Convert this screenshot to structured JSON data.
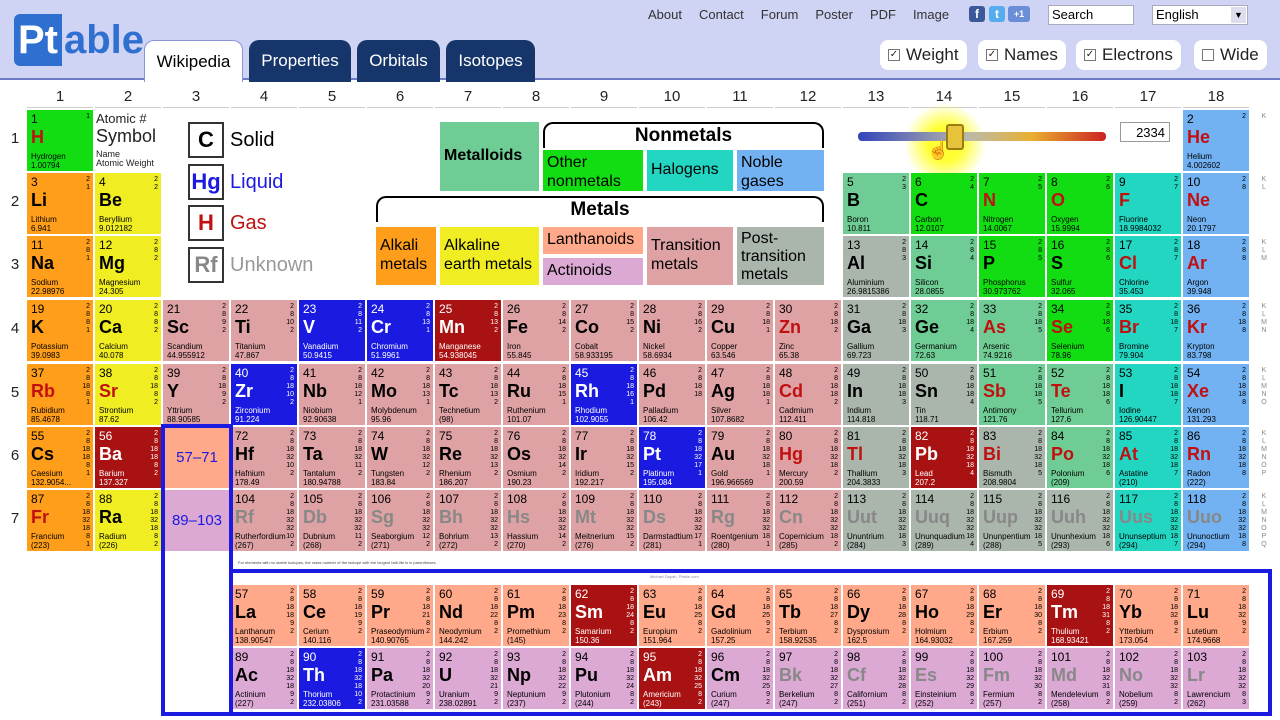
{
  "colors": {
    "header_bg": "#cfd3f4",
    "tab_dark": "#15356b",
    "accent": "#2e6fd0"
  },
  "logo": {
    "pt": "Pt",
    "able": "able"
  },
  "tabs": [
    {
      "label": "Wikipedia"
    },
    {
      "label": "Properties"
    },
    {
      "label": "Orbitals"
    },
    {
      "label": "Isotopes"
    }
  ],
  "toplinks": [
    "About",
    "Contact",
    "Forum",
    "Poster",
    "PDF",
    "Image"
  ],
  "social": [
    "f",
    "t",
    "+1"
  ],
  "search": {
    "placeholder": "Search"
  },
  "language": {
    "value": "English"
  },
  "options": [
    {
      "label": "Weight",
      "checked": true
    },
    {
      "label": "Names",
      "checked": true
    },
    {
      "label": "Electrons",
      "checked": true
    },
    {
      "label": "Wide",
      "checked": false
    }
  ],
  "groups": [
    "1",
    "2",
    "3",
    "4",
    "5",
    "6",
    "7",
    "8",
    "9",
    "10",
    "11",
    "12",
    "13",
    "14",
    "15",
    "16",
    "17",
    "18"
  ],
  "periods": [
    "1",
    "2",
    "3",
    "4",
    "5",
    "6",
    "7"
  ],
  "legend": {
    "atomic_label": "Atomic #",
    "symbol_label": "Symbol",
    "name_label": "Name",
    "weight_label": "Atomic Weight",
    "states": [
      {
        "sym": "C",
        "label": "Solid"
      },
      {
        "sym": "Hg",
        "label": "Liquid"
      },
      {
        "sym": "H",
        "label": "Gas"
      },
      {
        "sym": "Rf",
        "label": "Unknown"
      }
    ],
    "nonmetals_title": "Nonmetals",
    "metals_title": "Metals",
    "metalloids": "Metalloids",
    "other_nonmetals": "Other nonmetals",
    "halogens": "Halogens",
    "noble_gases": "Noble gases",
    "alkali": "Alkali metals",
    "alkaline_earth": "Alkaline earth metals",
    "lanthanoids": "Lanthanoids",
    "actinoids": "Actinoids",
    "transition": "Transition metals",
    "post_transition": "Post-transition metals"
  },
  "slider": {
    "temperature": "2334"
  },
  "ranges": {
    "lanth": "57–71",
    "actin": "89–103"
  },
  "footnote": "For elements with no stable isotopes, the mass number of the isotope with the longest half-life is in parentheses.",
  "copyright": "Michael Dayah. Ptable.com",
  "shell_letters": [
    "K",
    "KL",
    "KLM",
    "KLMN",
    "KLMNO",
    "KLMNOP",
    "KLMNOPQ"
  ],
  "elements": [
    [
      "1",
      "H",
      "Hydrogen",
      "1.00794",
      "1",
      "1",
      "1",
      "gas",
      "nonmetal"
    ],
    [
      "2",
      "He",
      "Helium",
      "4.002602",
      "1",
      "18",
      "2",
      "gas",
      "noble"
    ],
    [
      "3",
      "Li",
      "Lithium",
      "6.941",
      "2",
      "1",
      "2 1",
      "solid",
      "alkali"
    ],
    [
      "4",
      "Be",
      "Beryllium",
      "9.012182",
      "2",
      "2",
      "2 2",
      "solid",
      "alkaline"
    ],
    [
      "5",
      "B",
      "Boron",
      "10.811",
      "2",
      "13",
      "2 3",
      "solid",
      "metalloid"
    ],
    [
      "6",
      "C",
      "Carbon",
      "12.0107",
      "2",
      "14",
      "2 4",
      "solid",
      "nonmetal"
    ],
    [
      "7",
      "N",
      "Nitrogen",
      "14.0067",
      "2",
      "15",
      "2 5",
      "gas",
      "nonmetal"
    ],
    [
      "8",
      "O",
      "Oxygen",
      "15.9994",
      "2",
      "16",
      "2 6",
      "gas",
      "nonmetal"
    ],
    [
      "9",
      "F",
      "Fluorine",
      "18.9984032",
      "2",
      "17",
      "2 7",
      "gas",
      "halogen"
    ],
    [
      "10",
      "Ne",
      "Neon",
      "20.1797",
      "2",
      "18",
      "2 8",
      "gas",
      "noble"
    ],
    [
      "11",
      "Na",
      "Sodium",
      "22.98976",
      "3",
      "1",
      "2 8 1",
      "solid",
      "alkali"
    ],
    [
      "12",
      "Mg",
      "Magnesium",
      "24.305",
      "3",
      "2",
      "2 8 2",
      "solid",
      "alkaline"
    ],
    [
      "13",
      "Al",
      "Aluminium",
      "26.9815386",
      "3",
      "13",
      "2 8 3",
      "solid",
      "post"
    ],
    [
      "14",
      "Si",
      "Silicon",
      "28.0855",
      "3",
      "14",
      "2 8 4",
      "solid",
      "metalloid"
    ],
    [
      "15",
      "P",
      "Phosphorus",
      "30.973762",
      "3",
      "15",
      "2 8 5",
      "solid",
      "nonmetal"
    ],
    [
      "16",
      "S",
      "Sulfur",
      "32.065",
      "3",
      "16",
      "2 8 6",
      "solid",
      "nonmetal"
    ],
    [
      "17",
      "Cl",
      "Chlorine",
      "35.453",
      "3",
      "17",
      "2 8 7",
      "gas",
      "halogen"
    ],
    [
      "18",
      "Ar",
      "Argon",
      "39.948",
      "3",
      "18",
      "2 8 8",
      "gas",
      "noble"
    ],
    [
      "19",
      "K",
      "Potassium",
      "39.0983",
      "4",
      "1",
      "2 8 8 1",
      "solid",
      "alkali"
    ],
    [
      "20",
      "Ca",
      "Calcium",
      "40.078",
      "4",
      "2",
      "2 8 8 2",
      "solid",
      "alkaline"
    ],
    [
      "21",
      "Sc",
      "Scandium",
      "44.955912",
      "4",
      "3",
      "2 8 9 2",
      "solid",
      "transition"
    ],
    [
      "22",
      "Ti",
      "Titanium",
      "47.867",
      "4",
      "4",
      "2 8 10 2",
      "solid",
      "transition"
    ],
    [
      "23",
      "V",
      "Vanadium",
      "50.9415",
      "4",
      "5",
      "2 8 11 2",
      "liquid",
      "transition"
    ],
    [
      "24",
      "Cr",
      "Chromium",
      "51.9961",
      "4",
      "6",
      "2 8 13 1",
      "liquid",
      "transition"
    ],
    [
      "25",
      "Mn",
      "Manganese",
      "54.938045",
      "4",
      "7",
      "2 8 13 2",
      "gas",
      "transition"
    ],
    [
      "26",
      "Fe",
      "Iron",
      "55.845",
      "4",
      "8",
      "2 8 14 2",
      "solid",
      "transition"
    ],
    [
      "27",
      "Co",
      "Cobalt",
      "58.933195",
      "4",
      "9",
      "2 8 15 2",
      "solid",
      "transition"
    ],
    [
      "28",
      "Ni",
      "Nickel",
      "58.6934",
      "4",
      "10",
      "2 8 16 2",
      "solid",
      "transition"
    ],
    [
      "29",
      "Cu",
      "Copper",
      "63.546",
      "4",
      "11",
      "2 8 18 1",
      "solid",
      "transition"
    ],
    [
      "30",
      "Zn",
      "Zinc",
      "65.38",
      "4",
      "12",
      "2 8 18 2",
      "gas",
      "transition"
    ],
    [
      "31",
      "Ga",
      "Gallium",
      "69.723",
      "4",
      "13",
      "2 8 18 3",
      "solid",
      "post"
    ],
    [
      "32",
      "Ge",
      "Germanium",
      "72.63",
      "4",
      "14",
      "2 8 18 4",
      "solid",
      "metalloid"
    ],
    [
      "33",
      "As",
      "Arsenic",
      "74.9216",
      "4",
      "15",
      "2 8 18 5",
      "gas",
      "metalloid"
    ],
    [
      "34",
      "Se",
      "Selenium",
      "78.96",
      "4",
      "16",
      "2 8 18 6",
      "gas",
      "nonmetal"
    ],
    [
      "35",
      "Br",
      "Bromine",
      "79.904",
      "4",
      "17",
      "2 8 18 7",
      "gas",
      "halogen"
    ],
    [
      "36",
      "Kr",
      "Krypton",
      "83.798",
      "4",
      "18",
      "2 8 18 8",
      "gas",
      "noble"
    ],
    [
      "37",
      "Rb",
      "Rubidium",
      "85.4678",
      "5",
      "1",
      "2 8 18 8 1",
      "gas",
      "alkali"
    ],
    [
      "38",
      "Sr",
      "Strontium",
      "87.62",
      "5",
      "2",
      "2 8 18 8 2",
      "gas",
      "alkaline"
    ],
    [
      "39",
      "Y",
      "Yttrium",
      "88.90585",
      "5",
      "3",
      "2 8 18 9 2",
      "solid",
      "transition"
    ],
    [
      "40",
      "Zr",
      "Zirconium",
      "91.224",
      "5",
      "4",
      "2 8 18 10 2",
      "liquid",
      "transition"
    ],
    [
      "41",
      "Nb",
      "Niobium",
      "92.90638",
      "5",
      "5",
      "2 8 18 12 1",
      "solid",
      "transition"
    ],
    [
      "42",
      "Mo",
      "Molybdenum",
      "95.96",
      "5",
      "6",
      "2 8 18 13 1",
      "solid",
      "transition"
    ],
    [
      "43",
      "Tc",
      "Technetium",
      "(98)",
      "5",
      "7",
      "2 8 18 13 2",
      "solid",
      "transition"
    ],
    [
      "44",
      "Ru",
      "Ruthenium",
      "101.07",
      "5",
      "8",
      "2 8 18 15 1",
      "solid",
      "transition"
    ],
    [
      "45",
      "Rh",
      "Rhodium",
      "102.9055",
      "5",
      "9",
      "2 8 18 16 1",
      "liquid",
      "transition"
    ],
    [
      "46",
      "Pd",
      "Palladium",
      "106.42",
      "5",
      "10",
      "2 8 18 18",
      "solid",
      "transition"
    ],
    [
      "47",
      "Ag",
      "Silver",
      "107.8682",
      "5",
      "11",
      "2 8 18 18 1",
      "solid",
      "transition"
    ],
    [
      "48",
      "Cd",
      "Cadmium",
      "112.411",
      "5",
      "12",
      "2 8 18 18 2",
      "gas",
      "transition"
    ],
    [
      "49",
      "In",
      "Indium",
      "114.818",
      "5",
      "13",
      "2 8 18 18 3",
      "solid",
      "post"
    ],
    [
      "50",
      "Sn",
      "Tin",
      "118.71",
      "5",
      "14",
      "2 8 18 18 4",
      "solid",
      "post"
    ],
    [
      "51",
      "Sb",
      "Antimony",
      "121.76",
      "5",
      "15",
      "2 8 18 18 5",
      "gas",
      "metalloid"
    ],
    [
      "52",
      "Te",
      "Tellurium",
      "127.6",
      "5",
      "16",
      "2 8 18 18 6",
      "gas",
      "metalloid"
    ],
    [
      "53",
      "I",
      "Iodine",
      "126.90447",
      "5",
      "17",
      "2 8 18 18 7",
      "solid",
      "halogen"
    ],
    [
      "54",
      "Xe",
      "Xenon",
      "131.293",
      "5",
      "18",
      "2 8 18 18 8",
      "gas",
      "noble"
    ],
    [
      "55",
      "Cs",
      "Caesium",
      "132.9054...",
      "6",
      "1",
      "2 8 18 18 8 1",
      "solid",
      "alkali"
    ],
    [
      "56",
      "Ba",
      "Barium",
      "137.327",
      "6",
      "2",
      "2 8 18 18 8 2",
      "gas",
      "alkaline"
    ],
    [
      "72",
      "Hf",
      "Hafnium",
      "178.49",
      "6",
      "4",
      "2 8 18 32 10 2",
      "solid",
      "transition"
    ],
    [
      "73",
      "Ta",
      "Tantalum",
      "180.94788",
      "6",
      "5",
      "2 8 18 32 11 2",
      "solid",
      "transition"
    ],
    [
      "74",
      "W",
      "Tungsten",
      "183.84",
      "6",
      "6",
      "2 8 18 32 12 2",
      "solid",
      "transition"
    ],
    [
      "75",
      "Re",
      "Rhenium",
      "186.207",
      "6",
      "7",
      "2 8 18 32 13 2",
      "solid",
      "transition"
    ],
    [
      "76",
      "Os",
      "Osmium",
      "190.23",
      "6",
      "8",
      "2 8 18 32 14 2",
      "solid",
      "transition"
    ],
    [
      "77",
      "Ir",
      "Iridium",
      "192.217",
      "6",
      "9",
      "2 8 18 32 15 2",
      "solid",
      "transition"
    ],
    [
      "78",
      "Pt",
      "Platinum",
      "195.084",
      "6",
      "10",
      "2 8 18 32 17 1",
      "liquid",
      "transition"
    ],
    [
      "79",
      "Au",
      "Gold",
      "196.966569",
      "6",
      "11",
      "2 8 18 32 18 1",
      "solid",
      "transition"
    ],
    [
      "80",
      "Hg",
      "Mercury",
      "200.59",
      "6",
      "12",
      "2 8 18 32 18 2",
      "gas",
      "transition"
    ],
    [
      "81",
      "Tl",
      "Thallium",
      "204.3833",
      "6",
      "13",
      "2 8 18 32 18 3",
      "gas",
      "post"
    ],
    [
      "82",
      "Pb",
      "Lead",
      "207.2",
      "6",
      "14",
      "2 8 18 32 18 4",
      "gas",
      "post"
    ],
    [
      "83",
      "Bi",
      "Bismuth",
      "208.9804",
      "6",
      "15",
      "2 8 18 32 18 5",
      "gas",
      "post"
    ],
    [
      "84",
      "Po",
      "Polonium",
      "(209)",
      "6",
      "16",
      "2 8 18 32 18 6",
      "gas",
      "metalloid"
    ],
    [
      "85",
      "At",
      "Astatine",
      "(210)",
      "6",
      "17",
      "2 8 18 32 18 7",
      "gas",
      "halogen"
    ],
    [
      "86",
      "Rn",
      "Radon",
      "(222)",
      "6",
      "18",
      "2 8 18 32 18 8",
      "gas",
      "noble"
    ],
    [
      "87",
      "Fr",
      "Francium",
      "(223)",
      "7",
      "1",
      "2 8 18 32 18 8 1",
      "gas",
      "alkali"
    ],
    [
      "88",
      "Ra",
      "Radium",
      "(226)",
      "7",
      "2",
      "2 8 18 32 18 8 2",
      "solid",
      "alkaline"
    ],
    [
      "104",
      "Rf",
      "Rutherfordium",
      "(267)",
      "7",
      "4",
      "2 8 18 32 32 10 2",
      "unknown",
      "transition"
    ],
    [
      "105",
      "Db",
      "Dubnium",
      "(268)",
      "7",
      "5",
      "2 8 18 32 32 11 2",
      "unknown",
      "transition"
    ],
    [
      "106",
      "Sg",
      "Seaborgium",
      "(271)",
      "7",
      "6",
      "2 8 18 32 32 12 2",
      "unknown",
      "transition"
    ],
    [
      "107",
      "Bh",
      "Bohrium",
      "(272)",
      "7",
      "7",
      "2 8 18 32 32 13 2",
      "unknown",
      "transition"
    ],
    [
      "108",
      "Hs",
      "Hassium",
      "(270)",
      "7",
      "8",
      "2 8 18 32 32 14 2",
      "unknown",
      "transition"
    ],
    [
      "109",
      "Mt",
      "Meitnerium",
      "(276)",
      "7",
      "9",
      "2 8 18 32 32 15 2",
      "unknown",
      "transition"
    ],
    [
      "110",
      "Ds",
      "Darmstadtium",
      "(281)",
      "7",
      "10",
      "2 8 18 32 32 17 1",
      "unknown",
      "transition"
    ],
    [
      "111",
      "Rg",
      "Roentgenium",
      "(280)",
      "7",
      "11",
      "2 8 18 32 32 18 1",
      "unknown",
      "transition"
    ],
    [
      "112",
      "Cn",
      "Copernicium",
      "(285)",
      "7",
      "12",
      "2 8 18 32 32 18 2",
      "unknown",
      "transition"
    ],
    [
      "113",
      "Uut",
      "Ununtrium",
      "(284)",
      "7",
      "13",
      "2 8 18 32 32 18 3",
      "unknown",
      "post"
    ],
    [
      "114",
      "Uuq",
      "Ununquadium",
      "(289)",
      "7",
      "14",
      "2 8 18 32 32 18 4",
      "unknown",
      "post"
    ],
    [
      "115",
      "Uup",
      "Ununpentium",
      "(288)",
      "7",
      "15",
      "2 8 18 32 32 18 5",
      "unknown",
      "post"
    ],
    [
      "116",
      "Uuh",
      "Ununhexium",
      "(293)",
      "7",
      "16",
      "2 8 18 32 32 18 6",
      "unknown",
      "post"
    ],
    [
      "117",
      "Uus",
      "Ununseptium",
      "(294)",
      "7",
      "17",
      "2 8 18 32 32 18 7",
      "unknown",
      "halogen"
    ],
    [
      "118",
      "Uuo",
      "Ununoctium",
      "(294)",
      "7",
      "18",
      "2 8 18 32 32 18 8",
      "unknown",
      "noble"
    ],
    [
      "57",
      "La",
      "Lanthanum",
      "138.90547",
      "9",
      "4",
      "2 8 18 18 9 2",
      "solid",
      "lanth"
    ],
    [
      "58",
      "Ce",
      "Cerium",
      "140.116",
      "9",
      "5",
      "2 8 18 19 9 2",
      "solid",
      "lanth"
    ],
    [
      "59",
      "Pr",
      "Praseodymium",
      "140.90765",
      "9",
      "6",
      "2 8 18 21 8 2",
      "solid",
      "lanth"
    ],
    [
      "60",
      "Nd",
      "Neodymium",
      "144.242",
      "9",
      "7",
      "2 8 18 22 8 2",
      "solid",
      "lanth"
    ],
    [
      "61",
      "Pm",
      "Promethium",
      "(145)",
      "9",
      "8",
      "2 8 18 23 8 2",
      "solid",
      "lanth"
    ],
    [
      "62",
      "Sm",
      "Samarium",
      "150.36",
      "9",
      "9",
      "2 8 18 24 8 2",
      "gas",
      "lanth"
    ],
    [
      "63",
      "Eu",
      "Europium",
      "151.964",
      "9",
      "10",
      "2 8 18 25 8 2",
      "solid",
      "lanth"
    ],
    [
      "64",
      "Gd",
      "Gadolinium",
      "157.25",
      "9",
      "11",
      "2 8 18 25 9 2",
      "solid",
      "lanth"
    ],
    [
      "65",
      "Tb",
      "Terbium",
      "158.92535",
      "9",
      "12",
      "2 8 18 27 8 2",
      "solid",
      "lanth"
    ],
    [
      "66",
      "Dy",
      "Dysprosium",
      "162.5",
      "9",
      "13",
      "2 8 18 28 8 2",
      "solid",
      "lanth"
    ],
    [
      "67",
      "Ho",
      "Holmium",
      "164.93032",
      "9",
      "14",
      "2 8 18 29 8 2",
      "solid",
      "lanth"
    ],
    [
      "68",
      "Er",
      "Erbium",
      "167.259",
      "9",
      "15",
      "2 8 18 30 8 2",
      "solid",
      "lanth"
    ],
    [
      "69",
      "Tm",
      "Thulium",
      "168.93421",
      "9",
      "16",
      "2 8 18 31 8 2",
      "gas",
      "lanth"
    ],
    [
      "70",
      "Yb",
      "Ytterbium",
      "173.054",
      "9",
      "17",
      "2 8 18 32 8 2",
      "solid",
      "lanth"
    ],
    [
      "71",
      "Lu",
      "Lutetium",
      "174.9668",
      "9",
      "18",
      "2 8 18 32 9 2",
      "solid",
      "lanth"
    ],
    [
      "89",
      "Ac",
      "Actinium",
      "(227)",
      "10",
      "4",
      "2 8 18 32 18 9 2",
      "solid",
      "actin"
    ],
    [
      "90",
      "Th",
      "Thorium",
      "232.03806",
      "10",
      "5",
      "2 8 18 32 18 10 2",
      "liquid",
      "actin"
    ],
    [
      "91",
      "Pa",
      "Protactinium",
      "231.03588",
      "10",
      "6",
      "2 8 18 32 20 9 2",
      "solid",
      "actin"
    ],
    [
      "92",
      "U",
      "Uranium",
      "238.02891",
      "10",
      "7",
      "2 8 18 32 21 9 2",
      "solid",
      "actin"
    ],
    [
      "93",
      "Np",
      "Neptunium",
      "(237)",
      "10",
      "8",
      "2 8 18 32 22 9 2",
      "solid",
      "actin"
    ],
    [
      "94",
      "Pu",
      "Plutonium",
      "(244)",
      "10",
      "9",
      "2 8 18 32 24 8 2",
      "solid",
      "actin"
    ],
    [
      "95",
      "Am",
      "Americium",
      "(243)",
      "10",
      "10",
      "2 8 18 32 25 8 2",
      "gas",
      "actin"
    ],
    [
      "96",
      "Cm",
      "Curium",
      "(247)",
      "10",
      "11",
      "2 8 18 32 25 9 2",
      "solid",
      "actin"
    ],
    [
      "97",
      "Bk",
      "Berkelium",
      "(247)",
      "10",
      "12",
      "2 8 18 32 27 8 2",
      "unknown",
      "actin"
    ],
    [
      "98",
      "Cf",
      "Californium",
      "(251)",
      "10",
      "13",
      "2 8 18 32 28 8 2",
      "unknown",
      "actin"
    ],
    [
      "99",
      "Es",
      "Einsteinium",
      "(252)",
      "10",
      "14",
      "2 8 18 32 29 8 2",
      "unknown",
      "actin"
    ],
    [
      "100",
      "Fm",
      "Fermium",
      "(257)",
      "10",
      "15",
      "2 8 18 32 30 8 2",
      "unknown",
      "actin"
    ],
    [
      "101",
      "Md",
      "Mendelevium",
      "(258)",
      "10",
      "16",
      "2 8 18 32 31 8 2",
      "unknown",
      "actin"
    ],
    [
      "102",
      "No",
      "Nobelium",
      "(259)",
      "10",
      "17",
      "2 8 18 32 32 8 2",
      "unknown",
      "actin"
    ],
    [
      "103",
      "Lr",
      "Lawrencium",
      "(262)",
      "10",
      "18",
      "2 8 18 32 32 8 3",
      "unknown",
      "actin"
    ]
  ]
}
